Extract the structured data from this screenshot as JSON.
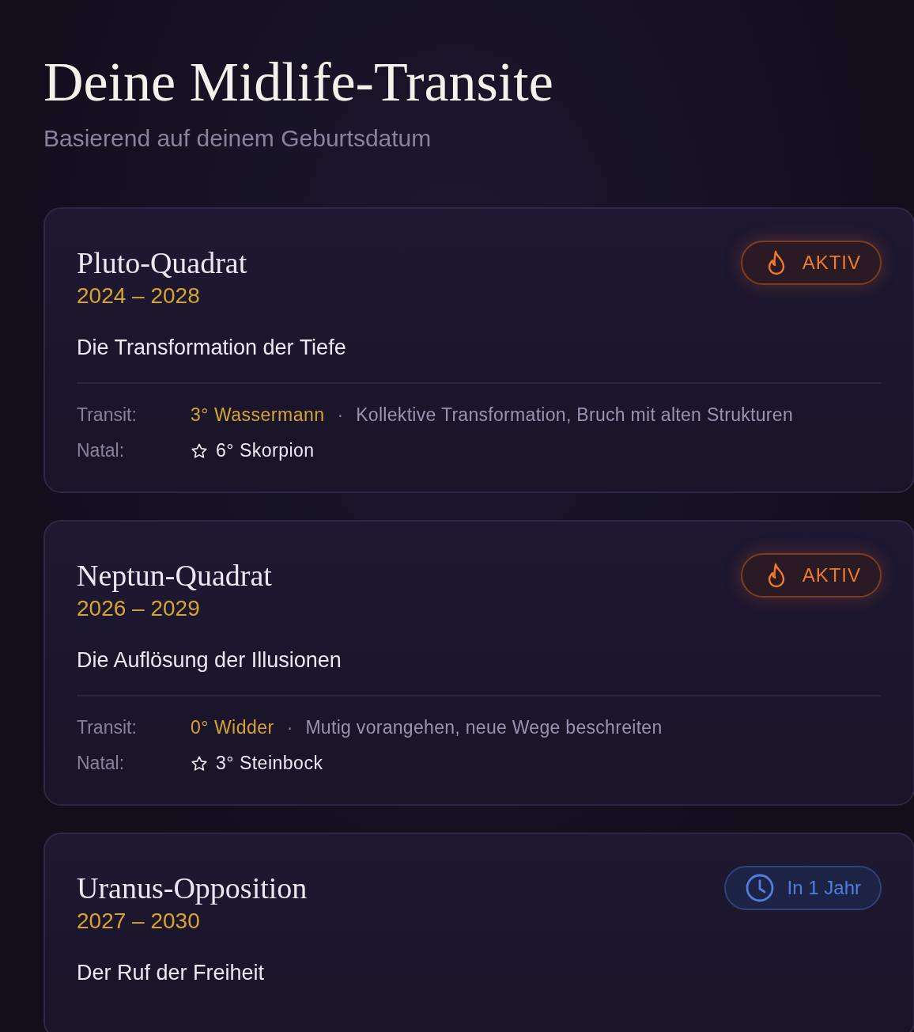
{
  "header": {
    "title": "Deine Midlife-Transite",
    "subtitle": "Basierend auf deinem Geburtsdatum"
  },
  "transits": [
    {
      "name": "Pluto-Quadrat",
      "years": "2024 – 2028",
      "theme": "Die Transformation der Tiefe",
      "badge": {
        "kind": "active",
        "label": "AKTIV"
      },
      "details": {
        "transit_label": "Transit:",
        "transit_position": "3° Wassermann",
        "separator": "·",
        "transit_meaning": "Kollektive Transformation, Bruch mit alten Strukturen",
        "natal_label": "Natal:",
        "natal_position": "6° Skorpion"
      }
    },
    {
      "name": "Neptun-Quadrat",
      "years": "2026 – 2029",
      "theme": "Die Auflösung der Illusionen",
      "badge": {
        "kind": "active",
        "label": "AKTIV"
      },
      "details": {
        "transit_label": "Transit:",
        "transit_position": "0° Widder",
        "separator": "·",
        "transit_meaning": "Mutig vorangehen, neue Wege beschreiten",
        "natal_label": "Natal:",
        "natal_position": "3° Steinbock"
      }
    },
    {
      "name": "Uranus-Opposition",
      "years": "2027 – 2030",
      "theme": "Der Ruf der Freiheit",
      "badge": {
        "kind": "upcoming",
        "label": "In 1 Jahr"
      }
    }
  ]
}
